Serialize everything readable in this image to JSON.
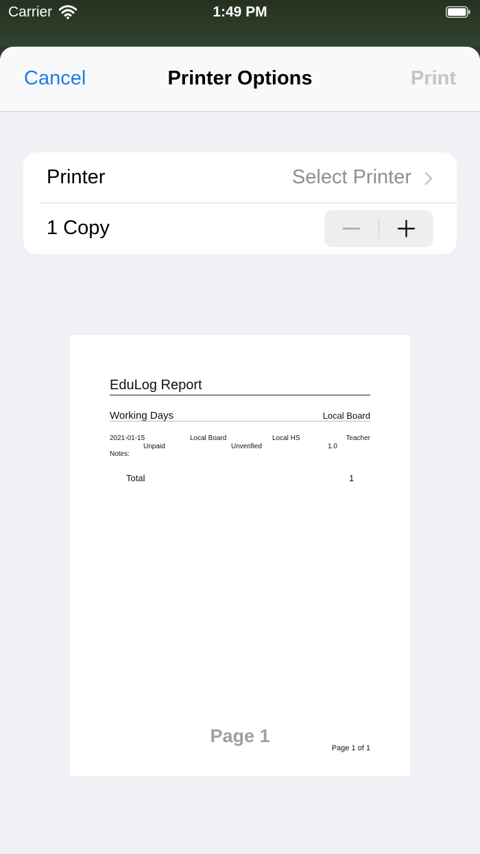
{
  "status_bar": {
    "carrier": "Carrier",
    "time": "1:49 PM",
    "icons": [
      "wifi-icon",
      "battery-icon"
    ]
  },
  "nav": {
    "cancel_label": "Cancel",
    "title": "Printer Options",
    "print_label": "Print"
  },
  "options": {
    "printer_label": "Printer",
    "printer_value": "Select Printer",
    "copies_label": "1 Copy"
  },
  "preview": {
    "report_title": "EduLog Report",
    "section_title": "Working Days",
    "section_right": "Local Board",
    "entry": {
      "date": "2021-01-15",
      "board": "Local Board",
      "school": "Local HS",
      "role": "Teacher",
      "pay_status": "Unpaid",
      "verification": "Unverified",
      "days": "1.0",
      "notes_label": "Notes:"
    },
    "total_label": "Total",
    "total_value": "1",
    "page_label": "Page 1",
    "page_count": "Page 1 of 1"
  },
  "colors": {
    "accent": "#1a7fe0",
    "disabled": "#c4c4c8",
    "secondary_text": "#8e8e93",
    "background": "#f0f0f5"
  }
}
